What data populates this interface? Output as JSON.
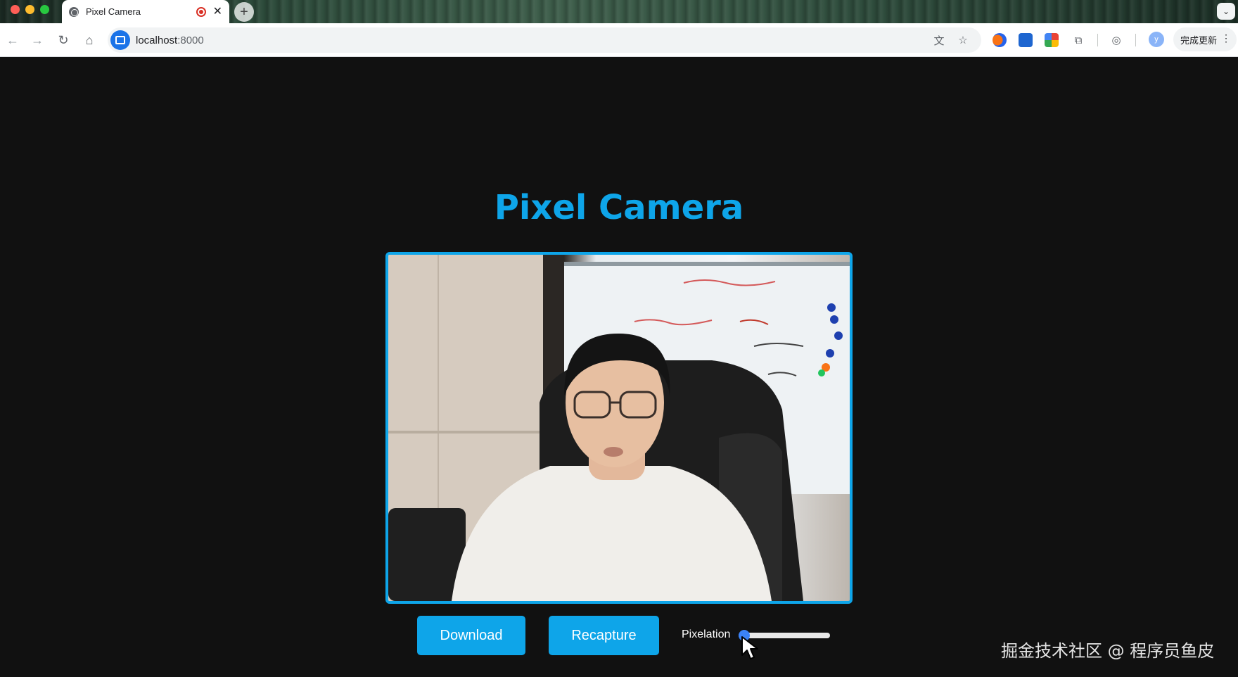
{
  "browser": {
    "tab_title": "Pixel Camera",
    "url_host": "localhost",
    "url_port": ":8000",
    "update_label": "完成更新",
    "profile_initial": "y"
  },
  "page": {
    "title": "Pixel Camera",
    "download_label": "Download",
    "recapture_label": "Recapture",
    "slider_label": "Pixelation",
    "pixelation_value": 0.0,
    "watermark": "掘金技术社区 @ 程序员鱼皮"
  },
  "colors": {
    "accent": "#0ea5e9",
    "background": "#111111",
    "slider": "#3b82f6"
  },
  "icons": {
    "back": "arrow-left-icon",
    "forward": "arrow-right-icon",
    "reload": "reload-icon",
    "home": "home-icon",
    "translate": "translate-icon",
    "bookmark": "star-icon",
    "extensions": "puzzle-icon",
    "screenshot": "camera-icon"
  }
}
